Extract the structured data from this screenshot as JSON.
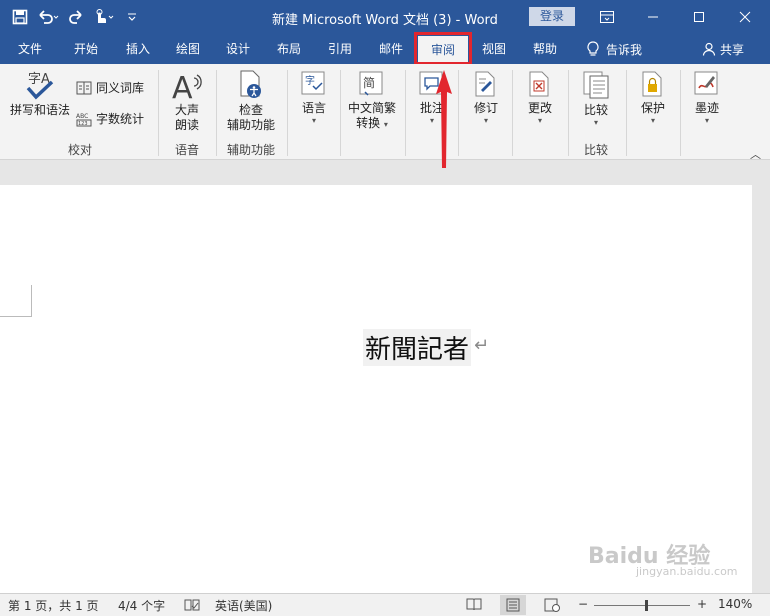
{
  "window": {
    "title": "新建 Microsoft Word 文档 (3)  -  Word",
    "login": "登录"
  },
  "tabs": [
    {
      "label": "文件"
    },
    {
      "label": "开始"
    },
    {
      "label": "插入"
    },
    {
      "label": "绘图"
    },
    {
      "label": "设计"
    },
    {
      "label": "布局"
    },
    {
      "label": "引用"
    },
    {
      "label": "邮件"
    },
    {
      "label": "审阅"
    },
    {
      "label": "视图"
    },
    {
      "label": "帮助"
    }
  ],
  "tell_me": "告诉我",
  "share": "共享",
  "ribbon": {
    "spelling": "拼写和语法",
    "thesaurus": "同义词库",
    "word_count": "字数统计",
    "read_aloud_1": "大声",
    "read_aloud_2": "朗读",
    "check_acc_1": "检查",
    "check_acc_2": "辅助功能",
    "language": "语言",
    "chinese_conv_1": "中文简繁",
    "chinese_conv_2": "转换",
    "comments": "批注",
    "tracking": "修订",
    "changes": "更改",
    "compare": "比较",
    "protect": "保护",
    "ink": "墨迹",
    "groups": {
      "proofing": "校对",
      "speech": "语音",
      "accessibility": "辅助功能",
      "compare": "比较"
    },
    "accent_color": "#2b579a",
    "highlight_color": "#e2262e"
  },
  "document": {
    "text": "新聞記者",
    "pilcrow": "↵"
  },
  "status": {
    "page": "第 1 页，共 1 页",
    "words": "4/4 个字",
    "language": "英语(美国)",
    "zoom_minus": "−",
    "zoom_plus": "+",
    "zoom": "140%"
  },
  "watermark": {
    "main": "Baidu 经验",
    "sub": "jingyan.baidu.com"
  }
}
